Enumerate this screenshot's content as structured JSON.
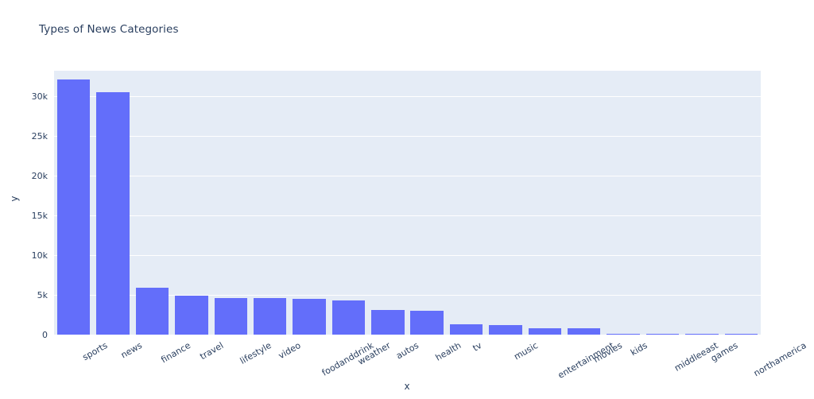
{
  "chart_data": {
    "type": "bar",
    "title": "Types of News Categories",
    "xlabel": "x",
    "ylabel": "y",
    "categories": [
      "sports",
      "news",
      "finance",
      "travel",
      "lifestyle",
      "video",
      "foodanddrink",
      "weather",
      "autos",
      "health",
      "tv",
      "music",
      "entertainment",
      "movies",
      "kids",
      "middleeast",
      "games",
      "northamerica"
    ],
    "values": [
      32100,
      30500,
      5900,
      4950,
      4600,
      4600,
      4500,
      4350,
      3100,
      3000,
      1300,
      1250,
      800,
      800,
      150,
      40,
      30,
      20
    ],
    "ylim": [
      0,
      33200
    ],
    "yticks": [
      0,
      5000,
      10000,
      15000,
      20000,
      25000,
      30000
    ],
    "ytick_labels": [
      "0",
      "5k",
      "10k",
      "15k",
      "20k",
      "25k",
      "30k"
    ],
    "grid": true,
    "legend": false,
    "bar_color": "#636efa",
    "plot_bgcolor": "#e5ecf6",
    "paper_bgcolor": "#ffffff",
    "font_color": "#2a3f5f"
  }
}
